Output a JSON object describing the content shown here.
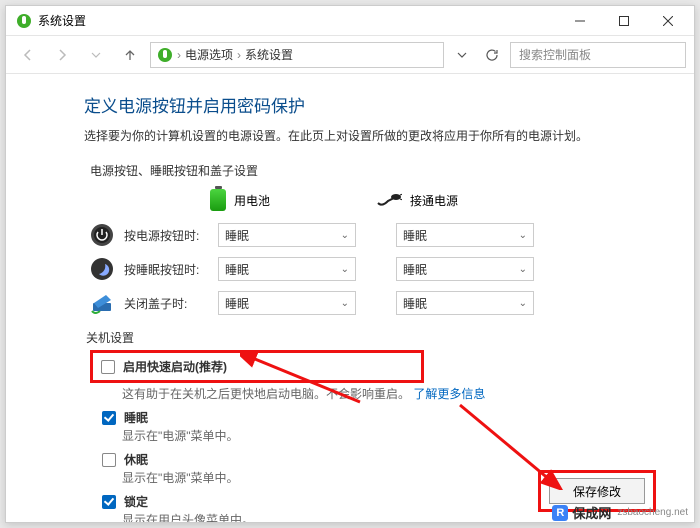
{
  "window": {
    "title": "系统设置",
    "min_label": "最小化",
    "max_label": "最大化",
    "close_label": "关闭"
  },
  "nav": {
    "back": "后退",
    "forward": "前进",
    "up": "上一级",
    "breadcrumb_1": "电源选项",
    "breadcrumb_2": "系统设置",
    "search_placeholder": "搜索控制面板"
  },
  "page": {
    "heading": "定义电源按钮并启用密码保护",
    "description": "选择要为你的计算机设置的电源设置。在此页上对设置所做的更改将应用于你所有的电源计划。"
  },
  "section1": {
    "title": "电源按钮、睡眠按钮和盖子设置",
    "col_battery": "用电池",
    "col_plugged": "接通电源",
    "row_power_btn": "按电源按钮时:",
    "row_sleep_btn": "按睡眠按钮时:",
    "row_lid": "关闭盖子时:",
    "value_sleep": "睡眠"
  },
  "section2": {
    "title": "关机设置",
    "fast_startup": "启用快速启动(推荐)",
    "fast_startup_desc_1": "这有助于在关机之后更快地启动电脑。不会影响重启。",
    "fast_startup_link": "了解更多信息",
    "sleep": "睡眠",
    "sleep_desc": "显示在\"电源\"菜单中。",
    "hibernate": "休眠",
    "hibernate_desc": "显示在\"电源\"菜单中。",
    "lock": "锁定",
    "lock_desc": "显示在用户头像菜单中。"
  },
  "footer": {
    "save_btn": "保存修改"
  },
  "watermark": {
    "cn": "保成网",
    "en": "zsbaocheng.net"
  }
}
